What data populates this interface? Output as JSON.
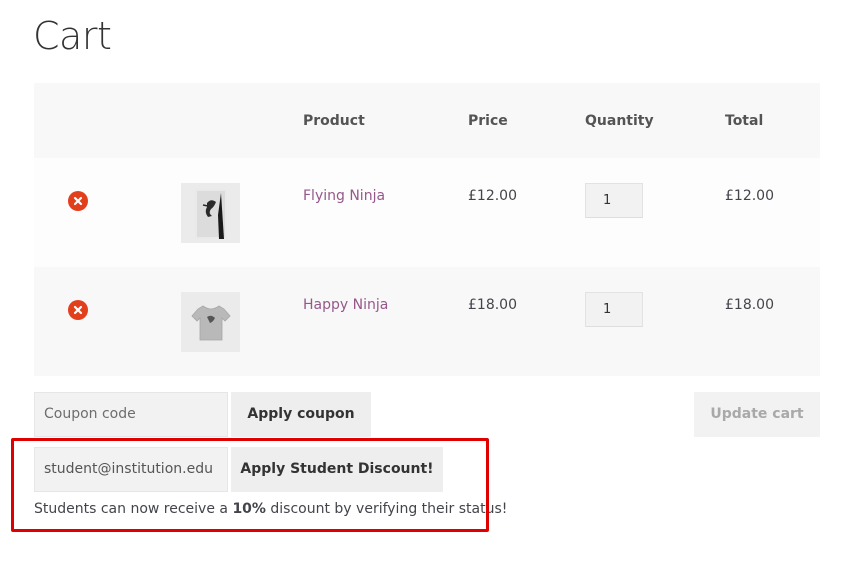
{
  "page": {
    "title": "Cart"
  },
  "table": {
    "headers": {
      "product": "Product",
      "price": "Price",
      "quantity": "Quantity",
      "total": "Total"
    },
    "rows": [
      {
        "product": "Flying Ninja",
        "price": "£12.00",
        "quantity": "1",
        "total": "£12.00",
        "thumb": "poster-ninja-icon"
      },
      {
        "product": "Happy Ninja",
        "price": "£18.00",
        "quantity": "1",
        "total": "£18.00",
        "thumb": "tshirt-icon"
      }
    ]
  },
  "coupon": {
    "placeholder": "Coupon code",
    "apply_label": "Apply coupon"
  },
  "update_label": "Update cart",
  "student": {
    "email_value": "student@institution.edu",
    "apply_label": "Apply Student Discount!",
    "notice_pre": "Students can now receive a ",
    "notice_bold": "10%",
    "notice_post": " discount by verifying their status!"
  },
  "colors": {
    "remove": "#e2401c",
    "link": "#96588a",
    "highlight": "#e00000"
  }
}
